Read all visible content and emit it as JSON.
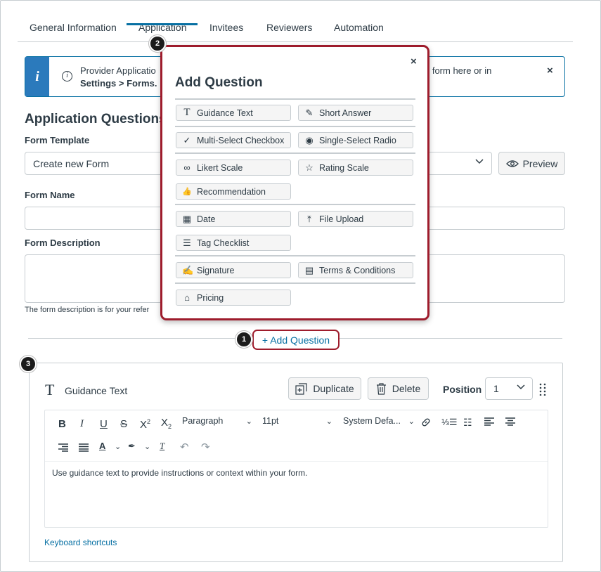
{
  "tabs": [
    {
      "label": "General Information"
    },
    {
      "label": "Application"
    },
    {
      "label": "Invitees"
    },
    {
      "label": "Reviewers"
    },
    {
      "label": "Automation"
    }
  ],
  "banner": {
    "text_start": "Provider Applicatio",
    "text_bold": "Settings > Forms.",
    "text_end": "n form here or in",
    "close": "×"
  },
  "form": {
    "heading": "Application Questions",
    "template_label": "Form Template",
    "template_value": "Create new Form",
    "preview_label": "Preview",
    "name_label": "Form Name",
    "desc_label": "Form Description",
    "desc_hint": "The form description is for your refer"
  },
  "add_question_button": "+ Add Question",
  "popover": {
    "title": "Add Question",
    "close": "×",
    "items": [
      {
        "label": "Guidance Text",
        "icon": "T"
      },
      {
        "label": "Short Answer",
        "icon": "✎"
      },
      {
        "label": "Multi-Select Checkbox",
        "icon": "✓"
      },
      {
        "label": "Single-Select Radio",
        "icon": "◉"
      },
      {
        "label": "Likert Scale",
        "icon": "∞"
      },
      {
        "label": "Rating Scale",
        "icon": "☆"
      },
      {
        "label": "Recommendation",
        "icon": "👍"
      },
      {
        "label": "Date",
        "icon": "▦"
      },
      {
        "label": "File Upload",
        "icon": "⤒"
      },
      {
        "label": "Tag Checklist",
        "icon": "☰"
      },
      {
        "label": "Signature",
        "icon": "✍"
      },
      {
        "label": "Terms & Conditions",
        "icon": "▤"
      },
      {
        "label": "Pricing",
        "icon": "⌂"
      }
    ]
  },
  "badges": [
    "1",
    "2",
    "3"
  ],
  "card": {
    "icon": "T",
    "title": "Guidance Text",
    "duplicate": "Duplicate",
    "delete": "Delete",
    "position_label": "Position",
    "position_value": "1",
    "paragraph": "Paragraph",
    "font_size": "11pt",
    "font_family": "System Defa...",
    "body": "Use guidance text to provide instructions or context within your form.",
    "keyboard_shortcuts": "Keyboard shortcuts"
  },
  "colors": {
    "accent": "#0770a3",
    "highlight": "#9e1c2c",
    "banner": "#2b7abc"
  }
}
